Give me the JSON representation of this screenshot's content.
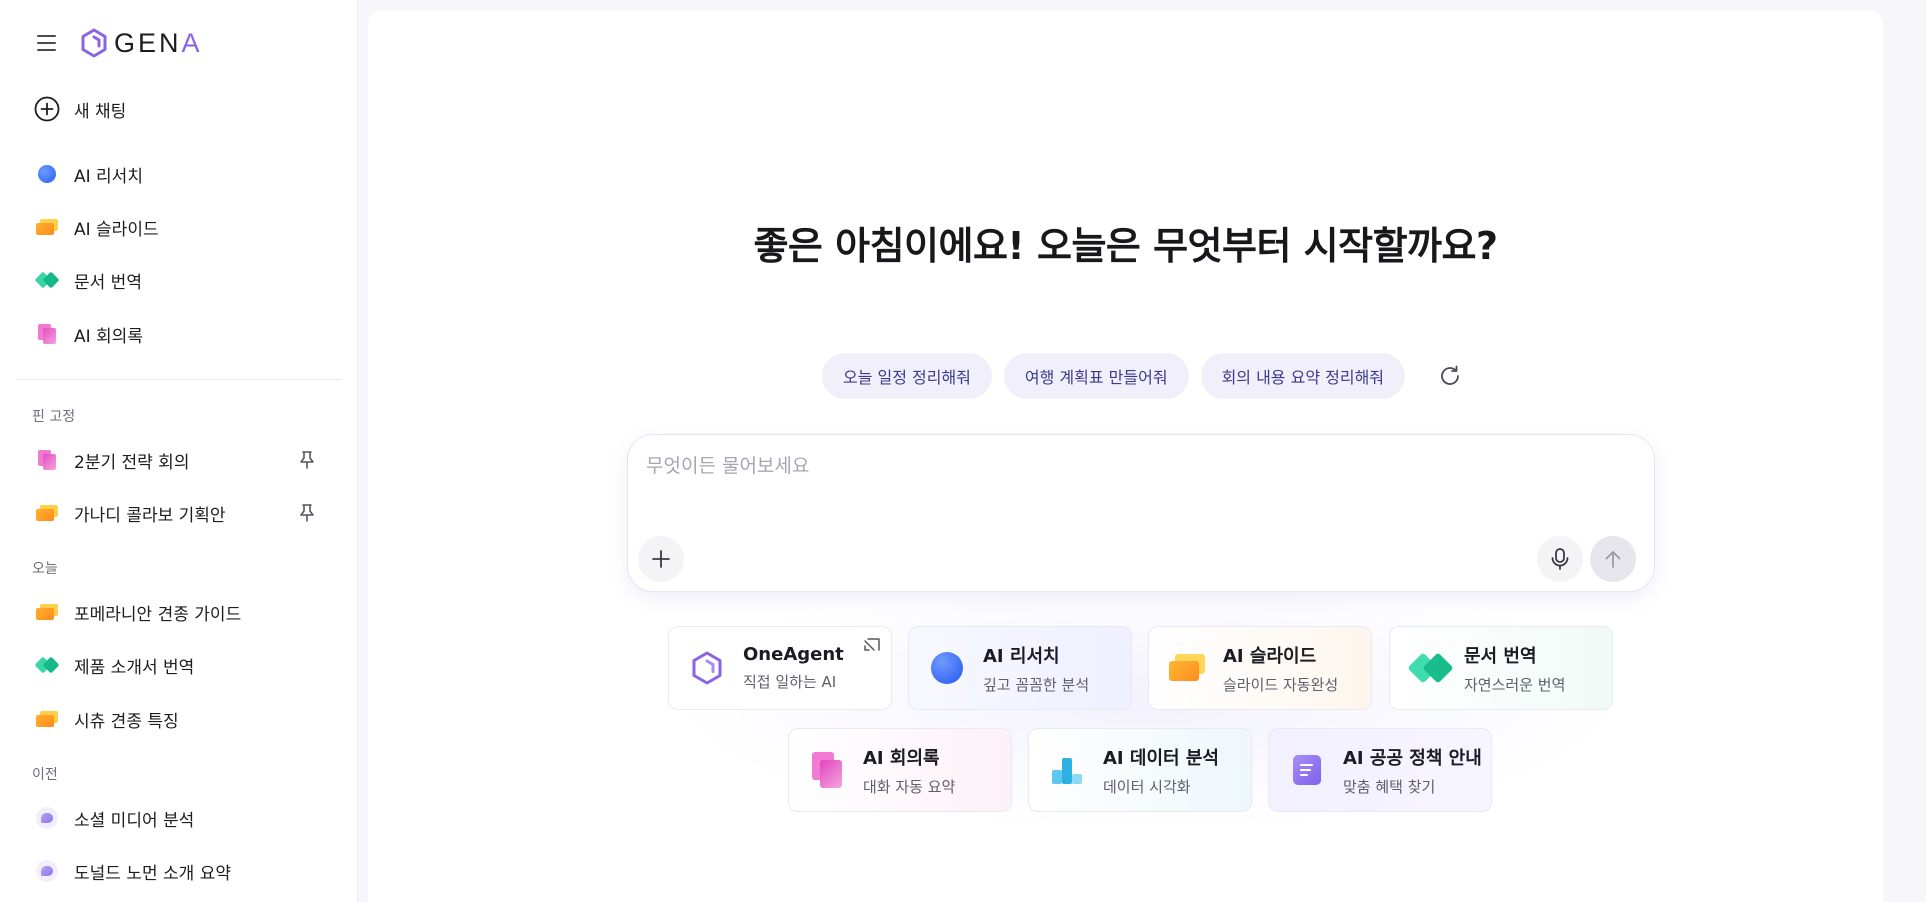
{
  "app": {
    "logo_main": "GEN",
    "logo_accent": "A"
  },
  "sidebar": {
    "new_chat": "새 채팅",
    "tools": [
      {
        "label": "AI 리서치",
        "icon": "research-icon"
      },
      {
        "label": "AI 슬라이드",
        "icon": "slides-icon"
      },
      {
        "label": "문서 번역",
        "icon": "translate-icon"
      },
      {
        "label": "AI 회의록",
        "icon": "minutes-icon"
      }
    ],
    "pinned_title": "핀 고정",
    "pinned": [
      {
        "label": "2분기 전략 회의",
        "icon": "minutes-icon"
      },
      {
        "label": "가나디 콜라보 기획안",
        "icon": "slides-icon"
      }
    ],
    "today_title": "오늘",
    "today": [
      {
        "label": "포메라니안 견종 가이드",
        "icon": "slides-icon"
      },
      {
        "label": "제품 소개서 번역",
        "icon": "translate-icon"
      },
      {
        "label": "시츄 견종 특징",
        "icon": "slides-icon"
      }
    ],
    "previous_title": "이전",
    "previous": [
      {
        "label": "소셜 미디어 분석",
        "icon": "chat-icon"
      },
      {
        "label": "도널드 노먼 소개 요약",
        "icon": "chat-icon"
      }
    ]
  },
  "main": {
    "headline": "좋은 아침이에요! 오늘은 무엇부터 시작할까요?",
    "suggestions": [
      "오늘 일정 정리해줘",
      "여행 계획표 만들어줘",
      "회의 내용 요약 정리해줘"
    ],
    "composer": {
      "placeholder": "무엇이든 물어보세요",
      "value": ""
    },
    "cards": [
      {
        "title": "OneAgent",
        "subtitle": "직접 일하는 AI",
        "icon": "oneagent-icon"
      },
      {
        "title": "AI 리서치",
        "subtitle": "깊고 꼼꼼한 분석",
        "icon": "research-icon"
      },
      {
        "title": "AI 슬라이드",
        "subtitle": "슬라이드 자동완성",
        "icon": "slides-icon"
      },
      {
        "title": "문서 번역",
        "subtitle": "자연스러운 번역",
        "icon": "translate-icon"
      },
      {
        "title": "AI 회의록",
        "subtitle": "대화 자동 요약",
        "icon": "minutes-icon"
      },
      {
        "title": "AI 데이터 분석",
        "subtitle": "데이터 시각화",
        "icon": "data-icon"
      },
      {
        "title": "AI 공공 정책 안내",
        "subtitle": "맞춤 혜택 찾기",
        "icon": "policy-icon"
      }
    ]
  },
  "colors": {
    "accent": "#8b63e6",
    "chip_bg": "#f1f0fa",
    "chip_text": "#3c3a8c"
  }
}
